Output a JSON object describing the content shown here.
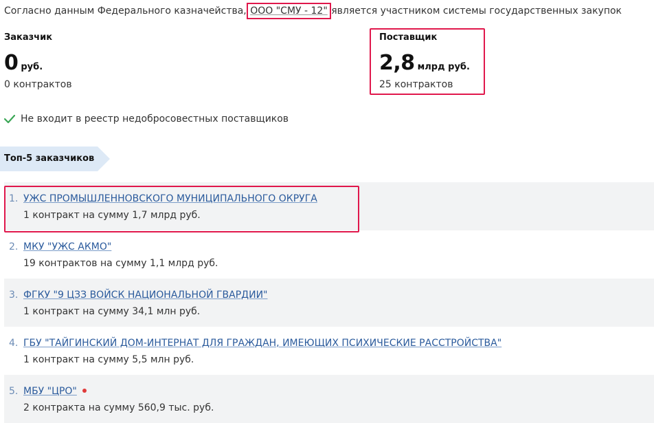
{
  "intro": {
    "prefix": "Согласно данным Федерального казначейства, ",
    "org_name": "ООО \"СМУ - 12\"",
    "suffix": " является участником системы государственных закупок"
  },
  "customer": {
    "title": "Заказчик",
    "value": "0",
    "unit": "руб.",
    "contracts": "0 контрактов"
  },
  "supplier": {
    "title": "Поставщик",
    "value": "2,8",
    "unit": "млрд руб.",
    "contracts": "25 контрактов"
  },
  "registry_status": {
    "text": "Не входит в реестр недобросовестных поставщиков",
    "icon": "check-icon",
    "color": "#3aa655"
  },
  "top_customers": {
    "heading": "Топ-5 заказчиков",
    "items": [
      {
        "index": "1.",
        "name": "УЖС ПРОМЫШЛЕННОВСКОГО МУНИЦИПАЛЬНОГО ОКРУГА",
        "desc": "1 контракт на сумму 1,7 млрд руб."
      },
      {
        "index": "2.",
        "name": "МКУ \"УЖС АКМО\"",
        "desc": "19 контрактов на сумму 1,1 млрд руб."
      },
      {
        "index": "3.",
        "name": "ФГКУ \"9 ЦЗЗ ВОЙСК НАЦИОНАЛЬНОЙ ГВАРДИИ\"",
        "desc": "1 контракт на сумму 34,1 млн руб."
      },
      {
        "index": "4.",
        "name": "ГБУ \"ТАЙГИНСКИЙ ДОМ-ИНТЕРНАТ ДЛЯ ГРАЖДАН, ИМЕЮЩИХ ПСИХИЧЕСКИЕ РАССТРОЙСТВА\"",
        "desc": "1 контракт на сумму 5,5 млн руб."
      },
      {
        "index": "5.",
        "name": "МБУ \"ЦРО\"",
        "desc": "2 контракта на сумму 560,9 тыс. руб."
      }
    ]
  },
  "colors": {
    "highlight": "#e0174b",
    "link": "#2a5a9c",
    "ribbon": "#dde9f6",
    "row_shade": "#f2f3f4",
    "status_dot": "#e03a3a"
  }
}
